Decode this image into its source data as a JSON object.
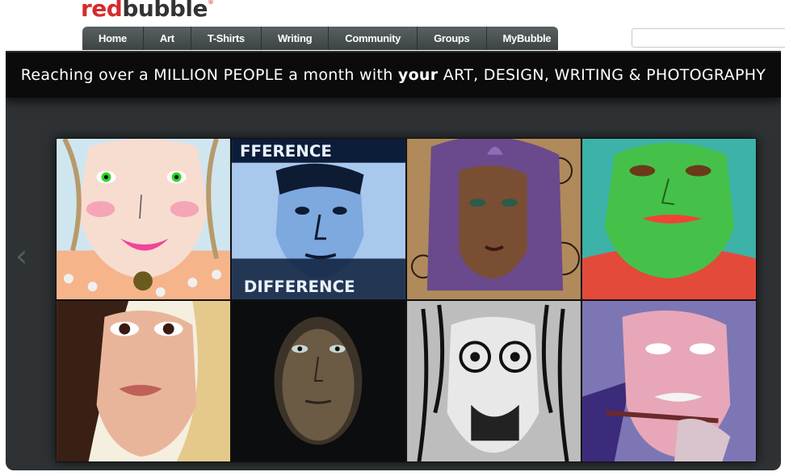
{
  "logo": {
    "red": "red",
    "black": "bubble",
    "reg": "®"
  },
  "nav": {
    "items": [
      "Home",
      "Art",
      "T-Shirts",
      "Writing",
      "Community",
      "Groups",
      "MyBubble"
    ]
  },
  "search": {
    "placeholder": ""
  },
  "banner": {
    "tagline_pre": "Reaching over a MILLION PEOPLE a month with ",
    "tagline_bold": "your",
    "tagline_post": " ART, DESIGN, WRITING & PHOTOGRAPHY",
    "prev_arrow": "‹"
  },
  "artworks": [
    {
      "name": "artwork-clown-face",
      "bg": "#f3d9c9"
    },
    {
      "name": "artwork-blue-portrait",
      "bg": "#8fb6e3"
    },
    {
      "name": "artwork-purple-hair-woman",
      "bg": "#8a6b4a"
    },
    {
      "name": "artwork-green-face",
      "bg": "#3fb1a6"
    },
    {
      "name": "artwork-woman-portrait",
      "bg": "#f3ecdc"
    },
    {
      "name": "artwork-dark-man-portrait",
      "bg": "#0e0f10"
    },
    {
      "name": "artwork-dreadlock-sketch",
      "bg": "#cfcfcf"
    },
    {
      "name": "artwork-old-man-painting",
      "bg": "#6f6aa8"
    }
  ],
  "colors": {
    "brand_red": "#d62b2b",
    "nav_bg": "#4a5153",
    "banner_bg": "#2e3234"
  }
}
